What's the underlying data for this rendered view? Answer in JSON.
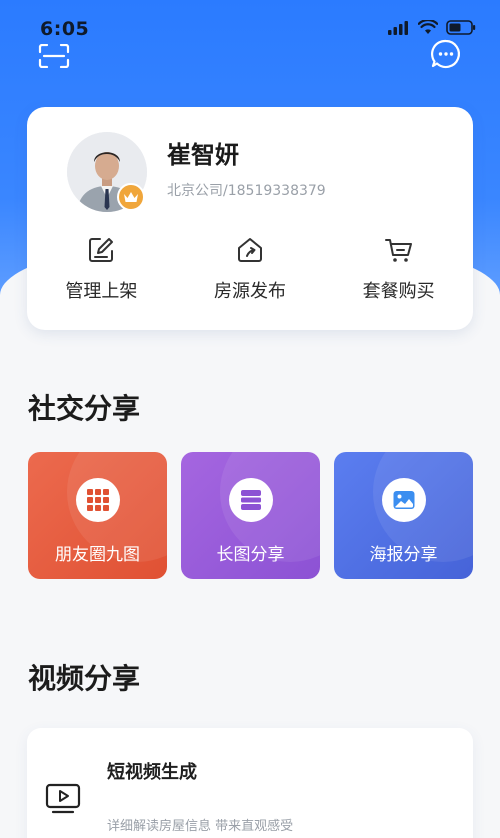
{
  "status": {
    "time": "6:05"
  },
  "profile": {
    "name": "崔智妍",
    "company": "北京公司/18519338379"
  },
  "actions": [
    {
      "label": "管理上架",
      "icon": "edit-icon"
    },
    {
      "label": "房源发布",
      "icon": "house-icon"
    },
    {
      "label": "套餐购买",
      "icon": "cart-icon"
    }
  ],
  "social": {
    "title": "社交分享",
    "tiles": [
      {
        "label": "朋友圈九图",
        "icon": "grid-icon",
        "color": "#e05133"
      },
      {
        "label": "长图分享",
        "icon": "long-image-icon",
        "color": "#8c52d4"
      },
      {
        "label": "海报分享",
        "icon": "poster-image-icon",
        "color": "#4663d8"
      }
    ]
  },
  "video": {
    "title": "视频分享",
    "card": {
      "title": "短视频生成",
      "desc": "详细解读房屋信息 带来直观感受",
      "icon": "video-play-icon"
    }
  },
  "colors": {
    "primary": "#2b7bff",
    "badge": "#f0a63b"
  }
}
